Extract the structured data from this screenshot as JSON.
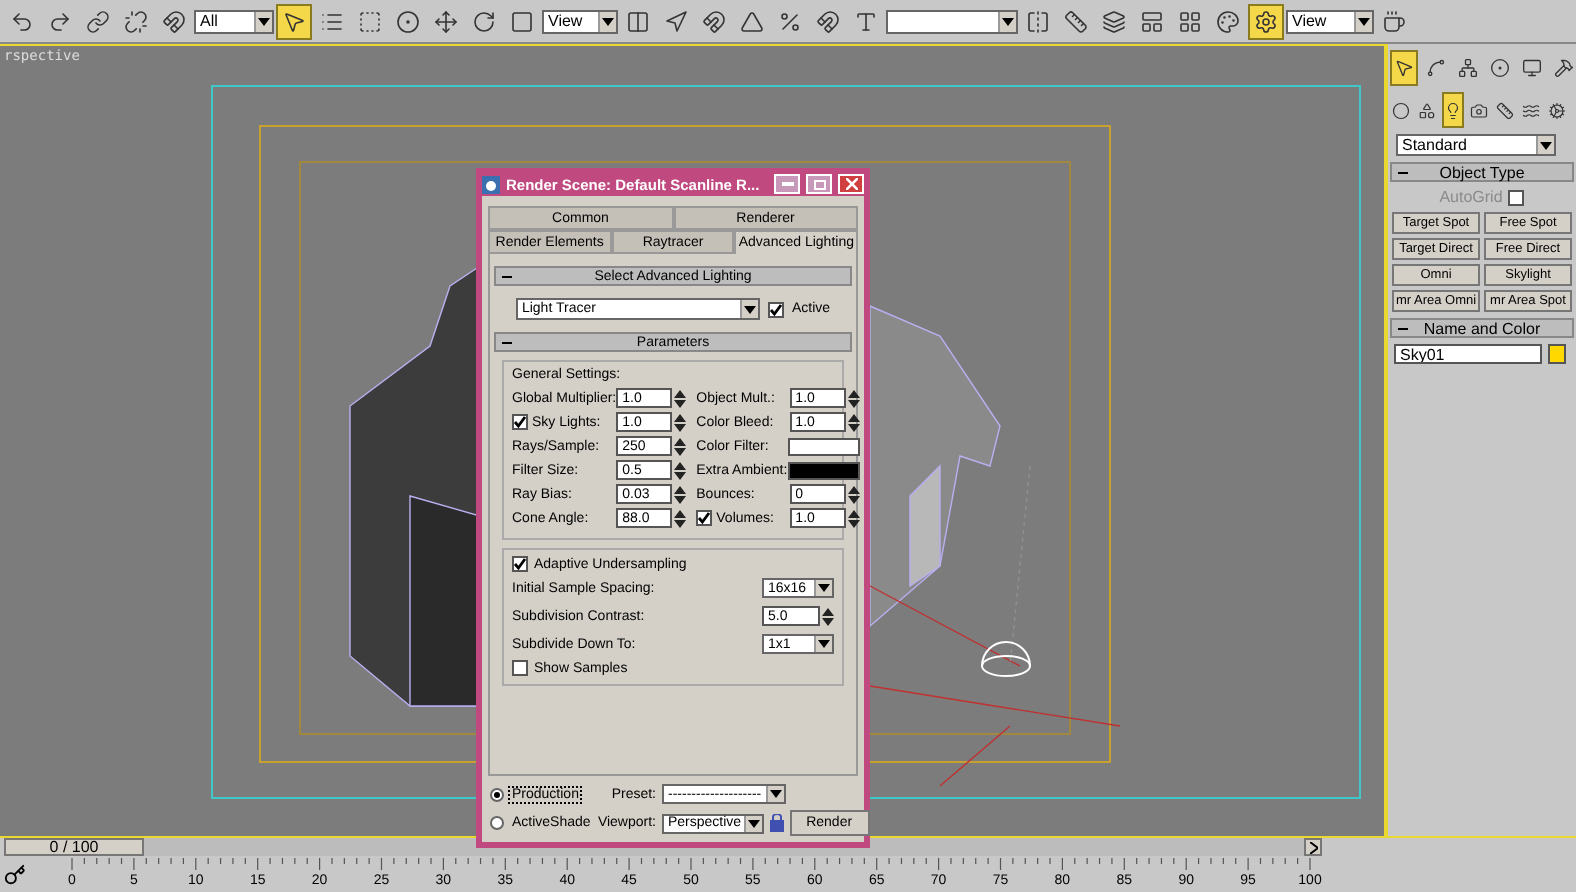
{
  "toolbar": {
    "selection_filter": "All",
    "reference_coordinate": "View",
    "viewport_layout": "View"
  },
  "viewport": {
    "label": "rspective"
  },
  "dialog": {
    "title": "Render Scene: Default Scanline R...",
    "tab_rows": [
      [
        {
          "label": "Common",
          "selected": false
        },
        {
          "label": "Renderer",
          "selected": false
        }
      ],
      [
        {
          "label": "Render Elements",
          "selected": false
        },
        {
          "label": "Raytracer",
          "selected": false
        },
        {
          "label": "Advanced Lighting",
          "selected": true
        }
      ]
    ],
    "select_rollout": {
      "title": "Select Advanced Lighting",
      "plugin": "Light Tracer",
      "active": {
        "label": "Active",
        "checked": true
      }
    },
    "parameters_rollout": {
      "title": "Parameters",
      "group_title": "General Settings:",
      "rows": [
        [
          {
            "kind": "spinner",
            "label": "Global Multiplier:",
            "value": "1.0"
          },
          {
            "kind": "spinner",
            "label": "Object Mult.:",
            "value": "1.0"
          }
        ],
        [
          {
            "kind": "spinner",
            "label": "Sky Lights:",
            "value": "1.0",
            "checked": true
          },
          {
            "kind": "spinner",
            "label": "Color Bleed:",
            "value": "1.0"
          }
        ],
        [
          {
            "kind": "spinner",
            "label": "Rays/Sample:",
            "value": "250"
          },
          {
            "kind": "swatch",
            "label": "Color Filter:",
            "color": "#ffffff"
          }
        ],
        [
          {
            "kind": "spinner",
            "label": "Filter Size:",
            "value": "0.5"
          },
          {
            "kind": "swatch",
            "label": "Extra Ambient:",
            "color": "#000000"
          }
        ],
        [
          {
            "kind": "spinner",
            "label": "Ray Bias:",
            "value": "0.03"
          },
          {
            "kind": "spinner",
            "label": "Bounces:",
            "value": "0"
          }
        ],
        [
          {
            "kind": "spinner",
            "label": "Cone Angle:",
            "value": "88.0"
          },
          {
            "kind": "spinner",
            "label": "Volumes:",
            "value": "1.0",
            "checked": true
          }
        ]
      ],
      "adaptive": {
        "label": "Adaptive Undersampling",
        "checked": true,
        "fields": [
          {
            "kind": "dropdown",
            "label": "Initial Sample Spacing:",
            "value": "16x16"
          },
          {
            "kind": "spinner",
            "label": "Subdivision Contrast:",
            "value": "5.0"
          },
          {
            "kind": "dropdown",
            "label": "Subdivide Down To:",
            "value": "1x1"
          }
        ],
        "show_samples": {
          "label": "Show Samples",
          "checked": false
        }
      }
    },
    "modes": [
      {
        "label": "Production",
        "selected": true
      },
      {
        "label": "ActiveShade",
        "selected": false
      }
    ],
    "preset": {
      "label": "Preset:",
      "value": "--------------------"
    },
    "viewport": {
      "label": "Viewport:",
      "value": "Perspective"
    },
    "render_button": "Render"
  },
  "command_panel": {
    "category": "Standard",
    "object_type": {
      "title": "Object Type",
      "autogrid": {
        "label": "AutoGrid",
        "checked": false,
        "disabled": true
      },
      "buttons": [
        "Target Spot",
        "Free Spot",
        "Target Direct",
        "Free Direct",
        "Omni",
        "Skylight",
        "mr Area Omni",
        "mr Area Spot"
      ]
    },
    "name_and_color": {
      "title": "Name and Color",
      "name": "Sky01",
      "color": "#ffd800"
    }
  },
  "timeline": {
    "position": "0 / 100",
    "level": 0,
    "ticks": [
      "0",
      "5",
      "10",
      "15",
      "20",
      "25",
      "30",
      "35",
      "40",
      "45",
      "50",
      "55",
      "60",
      "65",
      "70",
      "75",
      "80",
      "85",
      "90",
      "95",
      "100"
    ]
  }
}
